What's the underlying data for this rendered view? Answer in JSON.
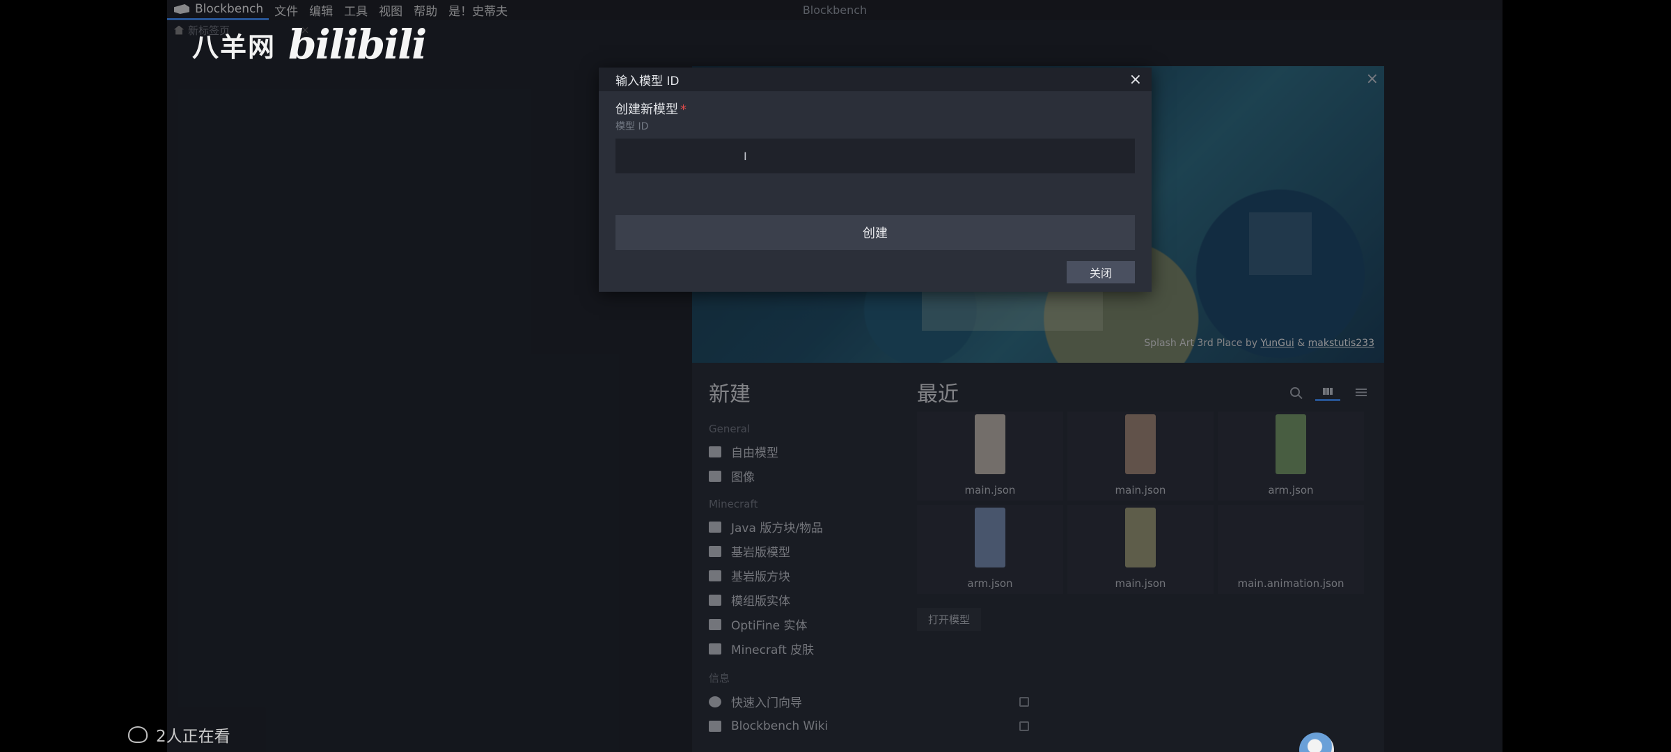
{
  "menubar": {
    "app_name": "Blockbench",
    "items": [
      "文件",
      "编辑",
      "工具",
      "视图",
      "帮助",
      "是！史蒂夫"
    ],
    "window_title": "Blockbench"
  },
  "tab": {
    "label": "新标签页",
    "close": "×"
  },
  "watermark": {
    "text": "八羊网",
    "logo": "bilibili"
  },
  "splash": {
    "credit_prefix": "Splash Art 3rd Place by ",
    "credit_author1": "YunGui",
    "credit_sep": " & ",
    "credit_author2": "makstutis233",
    "close": "×"
  },
  "new_section": {
    "title": "新建",
    "general_label": "General",
    "general_items": [
      "自由模型",
      "图像"
    ],
    "minecraft_label": "Minecraft",
    "minecraft_items": [
      "Java 版方块/物品",
      "基岩版模型",
      "基岩版方块",
      "模组版实体",
      "OptiFine 实体",
      "Minecraft 皮肤"
    ],
    "info_label": "信息",
    "info_items": [
      "快速入门向导",
      "Blockbench Wiki"
    ]
  },
  "recent": {
    "title": "最近",
    "files": [
      {
        "name": "main.json",
        "color": "#c9c0b4"
      },
      {
        "name": "main.json",
        "color": "#a88c7a"
      },
      {
        "name": "arm.json",
        "color": "#7aa06a"
      },
      {
        "name": "arm.json",
        "color": "#7b93b8"
      },
      {
        "name": "main.json",
        "color": "#a2a07a"
      },
      {
        "name": "main.animation.json",
        "color": "#2b2f39"
      }
    ],
    "open_button": "打开模型"
  },
  "dialog": {
    "title": "输入模型 ID",
    "close_icon": "×",
    "field_label": "创建新模型",
    "required_mark": "*",
    "field_sublabel": "模型 ID",
    "input_value": "",
    "cursor_glyph": "I",
    "create_button": "创建",
    "close_button": "关闭"
  },
  "viewers": {
    "text": "2人正在看"
  },
  "colors": {
    "accent": "#3e90ff",
    "dialog_bg": "#2b2f39",
    "app_bg": "#1d2027"
  }
}
